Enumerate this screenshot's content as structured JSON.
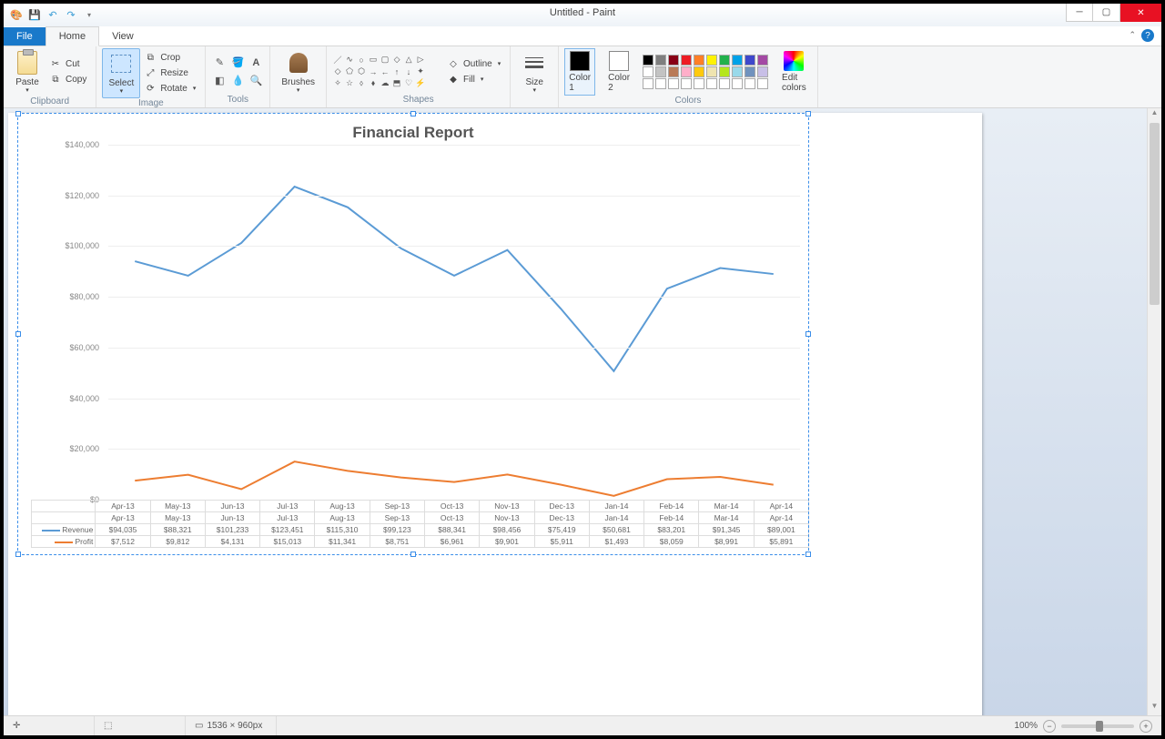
{
  "window": {
    "title": "Untitled - Paint"
  },
  "tabs": {
    "file": "File",
    "home": "Home",
    "view": "View"
  },
  "ribbon": {
    "clipboard": {
      "label": "Clipboard",
      "paste": "Paste",
      "cut": "Cut",
      "copy": "Copy"
    },
    "image": {
      "label": "Image",
      "select": "Select",
      "crop": "Crop",
      "resize": "Resize",
      "rotate": "Rotate"
    },
    "tools": {
      "label": "Tools"
    },
    "brushes": {
      "label": "Brushes",
      "btn": "Brushes"
    },
    "shapes": {
      "label": "Shapes",
      "outline": "Outline",
      "fill": "Fill"
    },
    "size": {
      "label": "Size",
      "btn": "Size"
    },
    "colors": {
      "label": "Colors",
      "color1": "Color\n1",
      "color2": "Color\n2",
      "edit": "Edit\ncolors",
      "palette": [
        "#000000",
        "#7f7f7f",
        "#880015",
        "#ed1c24",
        "#ff7f27",
        "#fff200",
        "#22b14c",
        "#00a2e8",
        "#3f48cc",
        "#a349a4",
        "#ffffff",
        "#c3c3c3",
        "#b97a57",
        "#ffaec9",
        "#ffc90e",
        "#efe4b0",
        "#b5e61d",
        "#99d9ea",
        "#7092be",
        "#c8bfe7"
      ]
    }
  },
  "status": {
    "canvas_size": "1536 × 960px",
    "zoom": "100%"
  },
  "chart_data": {
    "type": "line",
    "title": "Financial Report",
    "ylabel_prefix": "$",
    "ylim": [
      0,
      140000
    ],
    "yticks": [
      0,
      20000,
      40000,
      60000,
      80000,
      100000,
      120000,
      140000
    ],
    "categories": [
      "Apr-13",
      "May-13",
      "Jun-13",
      "Jul-13",
      "Aug-13",
      "Sep-13",
      "Oct-13",
      "Nov-13",
      "Dec-13",
      "Jan-14",
      "Feb-14",
      "Mar-14",
      "Apr-14"
    ],
    "series": [
      {
        "name": "Revenue",
        "color": "#5b9bd5",
        "values": [
          94035,
          88321,
          101233,
          123451,
          115310,
          99123,
          88341,
          98456,
          75419,
          50681,
          83201,
          91345,
          89001
        ],
        "display": [
          "$94,035",
          "$88,321",
          "$101,233",
          "$123,451",
          "$115,310",
          "$99,123",
          "$88,341",
          "$98,456",
          "$75,419",
          "$50,681",
          "$83,201",
          "$91,345",
          "$89,001"
        ]
      },
      {
        "name": "Profit",
        "color": "#ed7d31",
        "values": [
          7512,
          9812,
          4131,
          15013,
          11341,
          8751,
          6961,
          9901,
          5911,
          1493,
          8059,
          8991,
          5891
        ],
        "display": [
          "$7,512",
          "$9,812",
          "$4,131",
          "$15,013",
          "$11,341",
          "$8,751",
          "$6,961",
          "$9,901",
          "$5,911",
          "$1,493",
          "$8,059",
          "$8,991",
          "$5,891"
        ]
      }
    ]
  }
}
